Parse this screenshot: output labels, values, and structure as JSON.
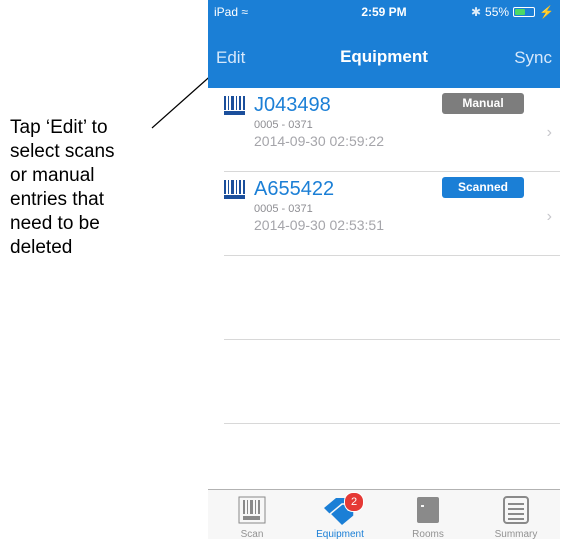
{
  "annotation": {
    "lines": [
      "Tap ‘Edit’ to",
      "select scans",
      "or manual",
      "entries that",
      "need to be",
      "deleted"
    ]
  },
  "statusbar": {
    "device": "iPad",
    "time": "2:59 PM",
    "battery": "55%",
    "battery_level": 0.55
  },
  "navbar": {
    "edit": "Edit",
    "title": "Equipment",
    "sync": "Sync"
  },
  "items": [
    {
      "code": "J043498",
      "sub": "0005 - 0371",
      "timestamp": "2014-09-30 02:59:22",
      "badge": "Manual",
      "badge_color": "#7d7d7d"
    },
    {
      "code": "A655422",
      "sub": "0005 - 0371",
      "timestamp": "2014-09-30 02:53:51",
      "badge": "Scanned",
      "badge_color": "#1b7fd6"
    }
  ],
  "tabs": [
    {
      "label": "Scan",
      "icon": "barcode-icon"
    },
    {
      "label": "Equipment",
      "icon": "tags-icon",
      "badge": "2",
      "active": true
    },
    {
      "label": "Rooms",
      "icon": "door-icon"
    },
    {
      "label": "Summary",
      "icon": "list-icon"
    }
  ],
  "colors": {
    "accent": "#1b7fd6"
  }
}
